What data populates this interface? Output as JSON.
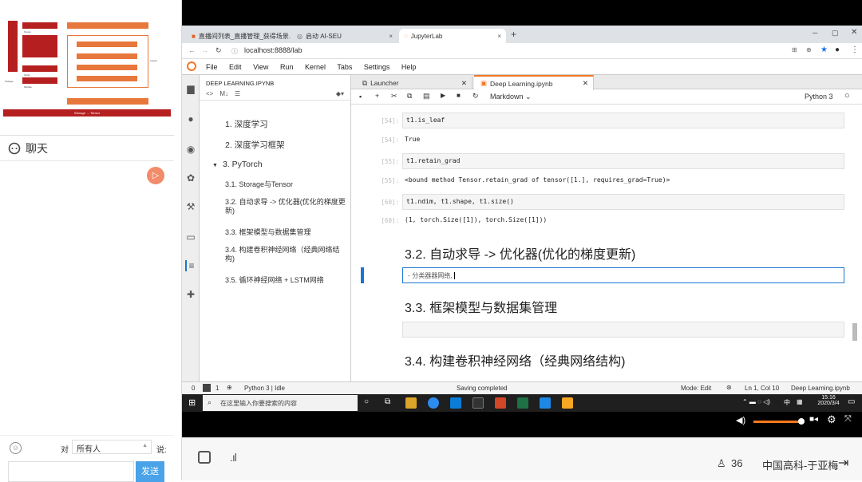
{
  "left_panel": {
    "chat_title": "聊天",
    "to_label": "对",
    "audience_select": "所有人",
    "say_label": "说:",
    "send_button": "发送",
    "slide_thumb": {
      "caption": "Storage → Tensor",
      "labels": [
        "Layers",
        "Tensor",
        "Storage",
        "Optim",
        "Module"
      ]
    }
  },
  "browser": {
    "tabs": [
      {
        "title": "直播间列表_直播管理_获得场景..."
      },
      {
        "title": "启动 AI-SEU"
      },
      {
        "title": "JupyterLab"
      }
    ],
    "address": "localhost:8888/lab"
  },
  "jupyter": {
    "menu": [
      "File",
      "Edit",
      "View",
      "Run",
      "Kernel",
      "Tabs",
      "Settings",
      "Help"
    ],
    "toc_title": "DEEP LEARNING.IPYNB",
    "toc_tools": [
      "<>",
      "M↓"
    ],
    "toc": [
      {
        "label": "1. 深度学习"
      },
      {
        "label": "2. 深度学习框架"
      },
      {
        "label": "3. PyTorch"
      },
      {
        "label": "3.1. Storage与Tensor"
      },
      {
        "label": "3.2. 自动求导 -> 优化器(优化的梯度更新)"
      },
      {
        "label": "3.3. 框架模型与数据集管理"
      },
      {
        "label": "3.4. 构建卷积神经网络（经典网络结构)"
      },
      {
        "label": "3.5. 循环神经网络 + LSTM网络"
      }
    ],
    "notebook_tabs": [
      {
        "title": "Launcher"
      },
      {
        "title": "Deep Learning.ipynb"
      }
    ],
    "cell_type": "Markdown",
    "kernel": "Python 3",
    "cells": [
      {
        "prompt": "[54]:",
        "input": "t1.is_leaf",
        "out_prompt": "[54]:",
        "output": "True"
      },
      {
        "prompt": "[55]:",
        "input": "t1.retain_grad",
        "out_prompt": "[55]:",
        "output": "<bound method Tensor.retain_grad of tensor([1.], requires_grad=True)>"
      },
      {
        "prompt": "[60]:",
        "input": "t1.ndim, t1.shape, t1.size()",
        "out_prompt": "[60]:",
        "output": "(1, torch.Size([1]), torch.Size([1]))"
      }
    ],
    "headings": [
      "3.2. 自动求导 -> 优化器(优化的梯度更新)",
      "3.3. 框架模型与数据集管理",
      "3.4. 构建卷积神经网络（经典网络结构)"
    ],
    "editing_text": "- 分类器器网络,",
    "status": {
      "left_num": "0",
      "count": "1",
      "kernel_state": "Python 3 | Idle",
      "saving": "Saving completed",
      "mode": "Mode: Edit",
      "position": "Ln 1, Col 10",
      "filename": "Deep Learning.ipynb"
    }
  },
  "taskbar": {
    "search_placeholder": "在这里输入你要搜索的内容",
    "time": "15:16",
    "date": "2020/3/4",
    "ime": "中",
    "app_colors": [
      "#dba42a",
      "#2d8cf0",
      "#0b7dd6",
      "#333333",
      "#d24726",
      "#1e7145",
      "#1e88e5",
      "#f6a623"
    ]
  },
  "bottom": {
    "viewer_count": "36",
    "presenter": "中国高科-于亚梅"
  },
  "colors": {
    "accent_red": "#b51f1f",
    "jupyter_orange": "#f37626",
    "send_blue": "#4aa3e8"
  }
}
